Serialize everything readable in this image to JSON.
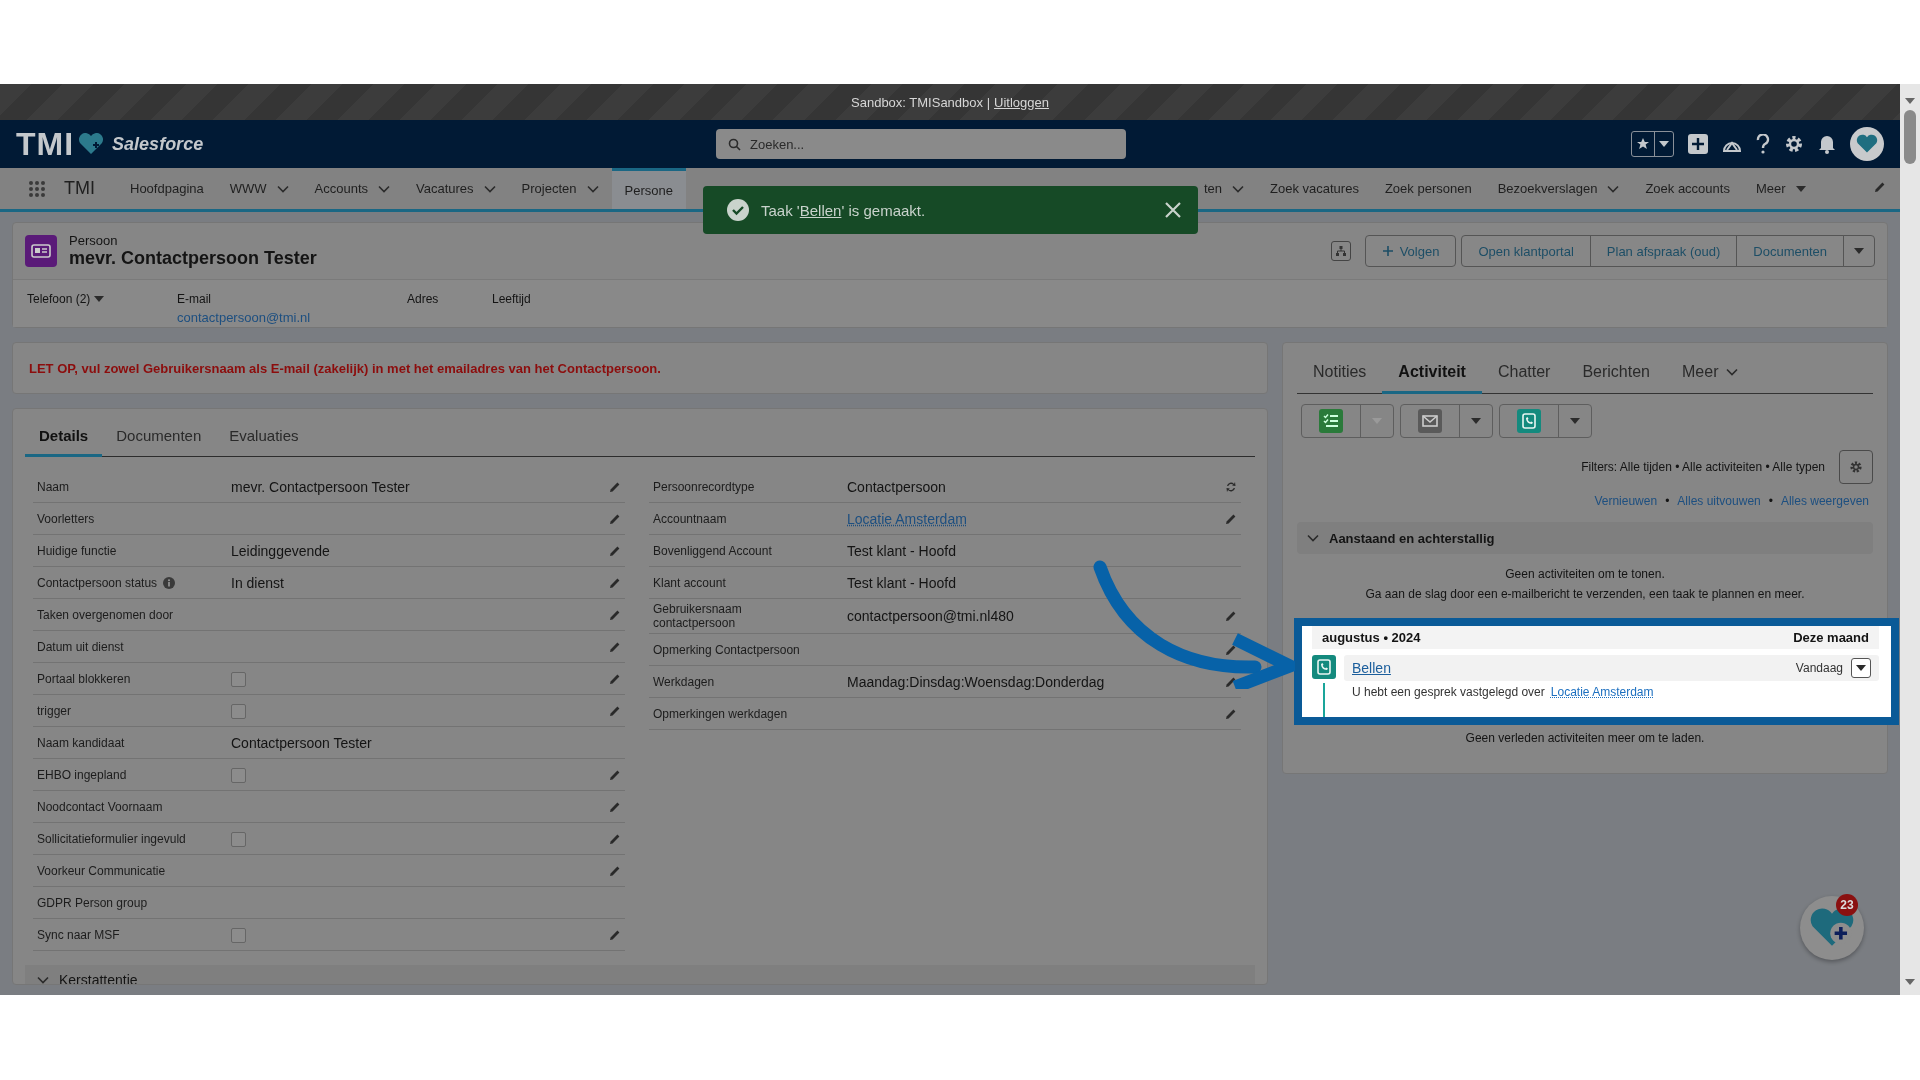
{
  "sandbox_bar": {
    "text": "Sandbox: TMISandbox |",
    "link": "Uitloggen"
  },
  "header": {
    "logo": "TMI",
    "brand": "Salesforce",
    "search": {
      "placeholder": "Zoeken..."
    }
  },
  "nav": {
    "app_name": "TMI",
    "items": [
      {
        "label": "Hoofdpagina",
        "dropdown": false,
        "selected": false
      },
      {
        "label": "WWW",
        "dropdown": true,
        "selected": false
      },
      {
        "label": "Accounts",
        "dropdown": true,
        "selected": false
      },
      {
        "label": "Vacatures",
        "dropdown": true,
        "selected": false
      },
      {
        "label": "Projecten",
        "dropdown": true,
        "selected": false
      },
      {
        "label": "Persone",
        "dropdown": false,
        "selected": true
      },
      {
        "label": "ten",
        "dropdown": true,
        "selected": false
      },
      {
        "label": "Zoek vacatures",
        "dropdown": false,
        "selected": false
      },
      {
        "label": "Zoek personen",
        "dropdown": false,
        "selected": false
      },
      {
        "label": "Bezoekverslagen",
        "dropdown": true,
        "selected": false
      },
      {
        "label": "Zoek accounts",
        "dropdown": false,
        "selected": false
      }
    ],
    "more": "Meer"
  },
  "toast": {
    "before": "Taak '",
    "link": "Bellen",
    "after": "' is gemaakt."
  },
  "record": {
    "type": "Persoon",
    "title": "mevr. Contactpersoon Tester",
    "actions": [
      "Volgen",
      "Open klantportal",
      "Plan afspraak (oud)",
      "Documenten"
    ],
    "fields": [
      {
        "label": "Telefoon (2)",
        "kind": "dropdown"
      },
      {
        "label": "E-mail",
        "value": "contactpersoon@tmi.nl",
        "kind": "link"
      },
      {
        "label": "Adres",
        "kind": "text"
      },
      {
        "label": "Leeftijd",
        "kind": "text"
      }
    ]
  },
  "warning": "LET OP, vul zowel Gebruikersnaam als E-mail (zakelijk) in met het emailadres van het Contactpersoon.",
  "details": {
    "tabs": [
      {
        "label": "Details",
        "selected": true
      },
      {
        "label": "Documenten",
        "selected": false
      },
      {
        "label": "Evaluaties",
        "selected": false
      }
    ],
    "left_fields": [
      {
        "label": "Naam",
        "value": "mevr. Contactpersoon Tester",
        "kind": "text",
        "editable": true
      },
      {
        "label": "Voorletters",
        "kind": "text",
        "editable": true
      },
      {
        "label": "Huidige functie",
        "value": "Leidinggevende",
        "kind": "text",
        "editable": true
      },
      {
        "label": "Contactpersoon status",
        "value": "In dienst",
        "kind": "text",
        "editable": true,
        "info": true
      },
      {
        "label": "Taken overgenomen door",
        "kind": "text",
        "editable": true
      },
      {
        "label": "Datum uit dienst",
        "kind": "text",
        "editable": true
      },
      {
        "label": "Portaal blokkeren",
        "kind": "checkbox",
        "checked": false,
        "editable": true
      },
      {
        "label": "trigger",
        "kind": "checkbox",
        "checked": false,
        "editable": true
      },
      {
        "label": "Naam kandidaat",
        "value": "Contactpersoon Tester",
        "kind": "text",
        "editable": false
      },
      {
        "label": "EHBO ingepland",
        "kind": "checkbox",
        "checked": false,
        "editable": true
      },
      {
        "label": "Noodcontact Voornaam",
        "kind": "text",
        "editable": true
      },
      {
        "label": "Sollicitatieformulier ingevuld",
        "kind": "checkbox",
        "checked": false,
        "editable": true
      },
      {
        "label": "Voorkeur Communicatie",
        "kind": "text",
        "editable": true
      },
      {
        "label": "GDPR Person group",
        "kind": "text",
        "editable": false
      },
      {
        "label": "Sync naar MSF",
        "kind": "checkbox",
        "checked": false,
        "editable": true
      }
    ],
    "right_fields": [
      {
        "label": "Persoonrecordtype",
        "value": "Contactpersoon",
        "kind": "text",
        "switchable": true
      },
      {
        "label": "Accountnaam",
        "value": "Locatie Amsterdam",
        "kind": "link",
        "editable": true
      },
      {
        "label": "Bovenliggend Account",
        "value": "Test klant - Hoofd",
        "kind": "text",
        "editable": false
      },
      {
        "label": "Klant account",
        "value": "Test klant - Hoofd",
        "kind": "text",
        "editable": false
      },
      {
        "label": "Gebruikersnaam contactpersoon",
        "value": "contactpersoon@tmi.nl480",
        "kind": "text",
        "editable": true
      },
      {
        "label": "Opmerking Contactpersoon",
        "kind": "text",
        "editable": true
      },
      {
        "label": "Werkdagen",
        "value": "Maandag:Dinsdag:Woensdag:Donderdag",
        "kind": "text",
        "editable": true
      },
      {
        "label": "Opmerkingen werkdagen",
        "kind": "text",
        "editable": true
      }
    ],
    "section": "Kerstattentie"
  },
  "activity": {
    "tabs": [
      {
        "label": "Notities",
        "selected": false
      },
      {
        "label": "Activiteit",
        "selected": true
      },
      {
        "label": "Chatter",
        "selected": false
      },
      {
        "label": "Berichten",
        "selected": false
      }
    ],
    "more": "Meer",
    "composers": [
      {
        "kind": "task",
        "disabled": true
      },
      {
        "kind": "email",
        "disabled": false
      },
      {
        "kind": "call",
        "disabled": false
      }
    ],
    "filters": "Filters: Alle tijden • Alle activiteiten • Alle typen",
    "links": [
      "Vernieuwen",
      "Alles uitvouwen",
      "Alles weergeven"
    ],
    "separators": [
      "•",
      "•"
    ],
    "upcoming": {
      "title": "Aanstaand en achterstallig",
      "empty": [
        "Geen activiteiten om te tonen.",
        "Ga aan de slag door een e-mailbericht te verzenden, een taak te plannen en meer."
      ]
    },
    "month": {
      "title": "augustus • 2024",
      "badge": "Deze maand"
    },
    "items": [
      {
        "kind": "call",
        "title": "Bellen",
        "date": "Vandaag",
        "text": "U hebt een gesprek vastgelegd over",
        "link": "Locatie Amsterdam"
      }
    ],
    "footer": "Geen verleden activiteiten meer om te laden."
  },
  "fab": {
    "badge": "23"
  }
}
